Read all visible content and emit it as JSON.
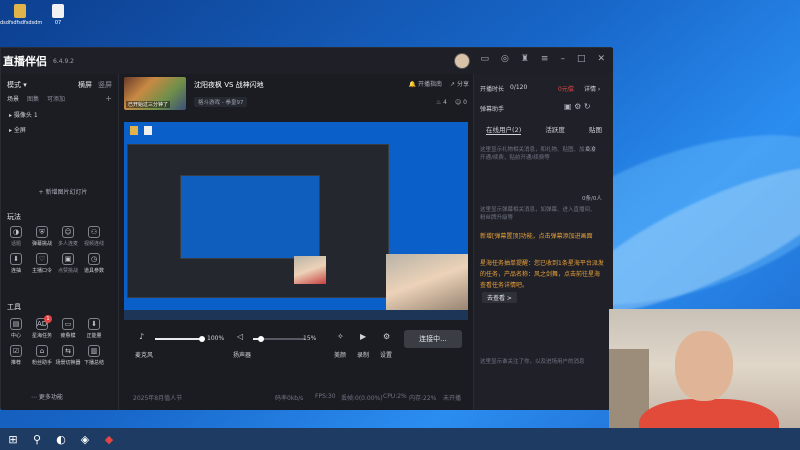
{
  "desktop": {
    "icons": [
      {
        "label": "dsdfsdfsdfsdsdm"
      },
      {
        "label": "07"
      }
    ]
  },
  "app": {
    "title": "直播伴侣",
    "version": "6.4.9.2"
  },
  "left": {
    "mode_label": "模式",
    "tab_a": "横屏",
    "tab_b": "竖屏",
    "scene_tabs": [
      "场景",
      "图集",
      "可添加"
    ],
    "scene_items": [
      "摄像头 1",
      "全屏"
    ],
    "add_label": "+ 新增图片幻灯片",
    "section_play": "玩法",
    "play_items": [
      "话题",
      "弹幕挑战",
      "多人连麦",
      "视频连线",
      "连抽",
      "主播口令",
      "点赞挑战",
      "道具参数"
    ],
    "section_tools": "工具",
    "tool_items": [
      "中心",
      "星海任务",
      "疲惫模",
      "正能量",
      "推荐",
      "粉丝助手",
      "场景切换器",
      "下播总结"
    ],
    "tool_badge": "1",
    "more_label": "更多功能"
  },
  "center": {
    "thumb_tag": "已开始过三分钟了",
    "stream_title": "沈阳夜枫 VS 战神闪地",
    "category": "格斗游戏 - 拳皇97",
    "top_link_1": "开播指南",
    "top_link_2": "分享",
    "count_likes": "4",
    "count_viewers": "0",
    "controls": {
      "mic_label": "麦克风",
      "mic_value": "100%",
      "speaker_label": "扬声器",
      "speaker_value": "15%",
      "beauty_label": "美颜",
      "record_label": "录制",
      "settings_label": "设置",
      "go_live_label": "连接中..."
    },
    "status": {
      "notice": "2025年8月值人节",
      "line_1": "码率0kb/s",
      "line_2": "FPS:30",
      "line_3": "丢帧:0(0.00%)",
      "line_4": "CPU:2%",
      "line_5": "内存:22%",
      "line_6": "未开播"
    }
  },
  "right": {
    "stream_time_label": "开播时长",
    "stream_time_value": "0/120",
    "reward_label": "0元偿",
    "detail_label": "详情",
    "assistant_label": "弹幕助手",
    "tabs": [
      "在线用户(2)",
      "活跃度",
      "贴图"
    ],
    "hint_1": "这里显示礼物相关消息，和礼物、贴图、加关注开通/续费，贴前开通/续费等",
    "hint_2": "这里显示弹幕相关消息，如弹幕、进入直播间、粉丝牌升级等",
    "count_1": "0.0",
    "count_2": "0条/0人",
    "msg_1": "新增[弹幕置顶]功能，点击弹幕添加进画面",
    "msg_2": "星海任务抽单提醒：您已收到1条星海平台派发的任务，产品名称：风之剑舞，点击前往星海查看任务详情吧。",
    "link_label": "去查看 >",
    "hint_3": "这里显示谁关注了你，以及进场用户的消息"
  },
  "colors": {
    "accent": "#e34545",
    "message_orange": "#e9a13b",
    "panel_bg": "#1b1c22"
  }
}
